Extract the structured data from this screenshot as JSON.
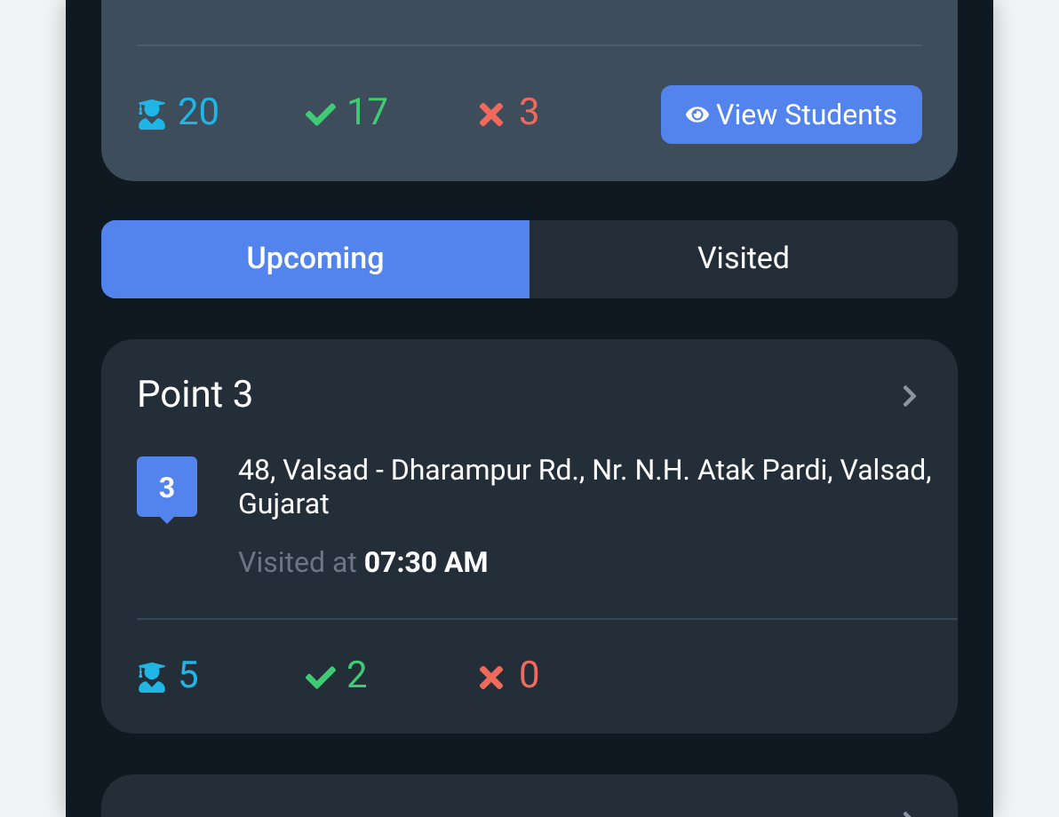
{
  "summary_card": {
    "stats": [
      {
        "kind": "students",
        "value": "20"
      },
      {
        "kind": "present",
        "value": "17"
      },
      {
        "kind": "absent",
        "value": "3"
      }
    ],
    "button": "View Students"
  },
  "tabs": [
    {
      "label": "Upcoming",
      "selected": true
    },
    {
      "label": "Visited",
      "selected": false
    }
  ],
  "points": [
    {
      "title": "Point 3",
      "marker": "3",
      "address": "48, Valsad - Dharampur Rd., Nr. N.H. Atak Pardi, Valsad, Gujarat",
      "visited": "Visited at **07:30 AM**",
      "stats": [
        {
          "kind": "students",
          "value": "5"
        },
        {
          "kind": "present",
          "value": "2"
        },
        {
          "kind": "absent",
          "value": "0"
        }
      ]
    }
  ]
}
